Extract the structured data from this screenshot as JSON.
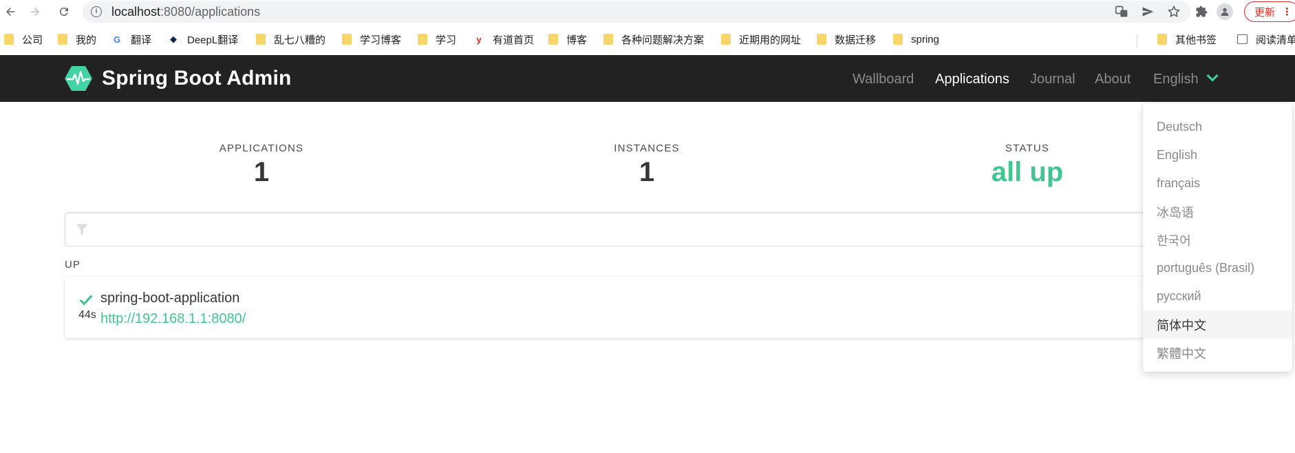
{
  "browser": {
    "url_host": "localhost",
    "url_path": ":8080/applications",
    "update_label": "更新"
  },
  "bookmarks": [
    {
      "label": "公司",
      "icon": "folder-icon"
    },
    {
      "label": "我的",
      "icon": "folder-icon"
    },
    {
      "label": "翻译",
      "icon": "google-translate-icon"
    },
    {
      "label": "DeepL翻译",
      "icon": "deepl-icon"
    },
    {
      "label": "乱七八糟的",
      "icon": "folder-icon"
    },
    {
      "label": "学习博客",
      "icon": "folder-icon"
    },
    {
      "label": "学习",
      "icon": "folder-icon"
    },
    {
      "label": "有道首页",
      "icon": "youdao-icon"
    },
    {
      "label": "博客",
      "icon": "folder-icon"
    },
    {
      "label": "各种问题解决方案",
      "icon": "folder-icon"
    },
    {
      "label": "近期用的网址",
      "icon": "folder-icon"
    },
    {
      "label": "数据迁移",
      "icon": "folder-icon"
    },
    {
      "label": "spring",
      "icon": "folder-icon"
    },
    {
      "label": "其他书签",
      "icon": "folder-icon"
    },
    {
      "label": "阅读清单",
      "icon": "reading-list-icon"
    }
  ],
  "app": {
    "brand": "Spring Boot Admin",
    "nav": [
      "Wallboard",
      "Applications",
      "Journal",
      "About",
      "English"
    ],
    "active_nav": "Applications",
    "accent_color": "#42d3a5"
  },
  "stats": {
    "applications_label": "APPLICATIONS",
    "applications_value": "1",
    "instances_label": "INSTANCES",
    "instances_value": "1",
    "status_label": "STATUS",
    "status_value": "all up"
  },
  "filter": {
    "placeholder": ""
  },
  "group": {
    "title": "UP",
    "app_name": "spring-boot-application",
    "uptime": "44s",
    "url": "http://192.168.1.1:8080/"
  },
  "languages": [
    "Deutsch",
    "English",
    "français",
    "冰岛语",
    "한국어",
    "português (Brasil)",
    "русский",
    "简体中文",
    "繁體中文"
  ],
  "hovered_language": "简体中文"
}
